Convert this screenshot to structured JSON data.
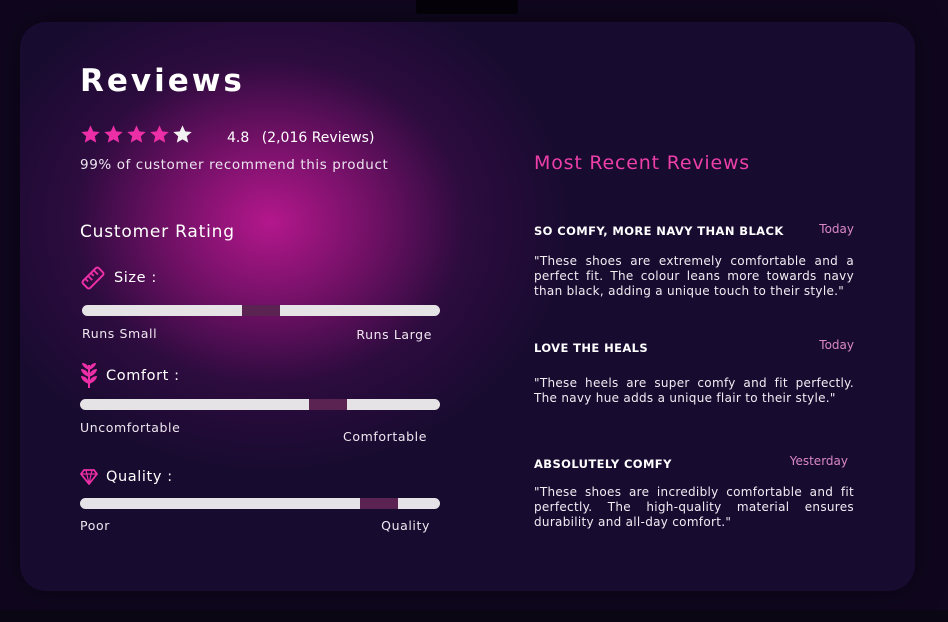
{
  "reviews_panel": {
    "title": "Reviews",
    "rating": {
      "value": "4.8",
      "count_text": "(2,016 Reviews)",
      "stars_filled": 4,
      "stars_total": 5,
      "star_color_filled": "#ec2fa6",
      "star_color_empty": "#f2f2f2"
    },
    "recommend_text": "99% of customer recommend this product"
  },
  "customer_rating": {
    "title": "Customer Rating",
    "marker_color": "#5b2351",
    "track_color": "#e6e3e6",
    "metrics": [
      {
        "label": "Size :",
        "icon": "ruler-icon",
        "left_label": "Runs Small",
        "right_label": "Runs Large",
        "level_percent": 50
      },
      {
        "label": "Comfort :",
        "icon": "leaf-icon",
        "left_label": "Uncomfortable",
        "right_label": "Comfortable",
        "level_percent": 69
      },
      {
        "label": "Quality :",
        "icon": "diamond-icon",
        "left_label": "Poor",
        "right_label": "Quality",
        "level_percent": 83
      }
    ]
  },
  "recent_reviews": {
    "title": "Most Recent Reviews",
    "accent_color": "#ec3fa8",
    "items": [
      {
        "title": "SO COMFY, MORE NAVY THAN BLACK",
        "date": "Today",
        "body": "\"These shoes are extremely comfortable and a perfect fit. The colour leans more towards navy than black, adding a unique touch to their style.\""
      },
      {
        "title": "LOVE THE HEALS",
        "date": "Today",
        "body": "\"These heels are super comfy and fit perfectly. The navy hue adds a unique flair to their style.\""
      },
      {
        "title": "ABSOLUTELY COMFY",
        "date": "Yesterday",
        "body": "\"These shoes are incredibly comfortable and fit perfectly. The high-quality material ensures durability and all-day comfort.\""
      }
    ]
  }
}
